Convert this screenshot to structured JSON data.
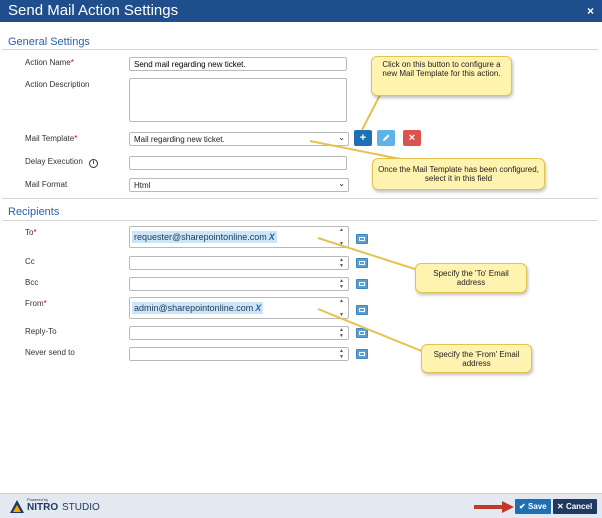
{
  "window": {
    "title": "Send Mail Action Settings",
    "close_glyph": "×"
  },
  "general": {
    "heading": "General Settings",
    "action_name_label": "Action Name",
    "action_name_value": "Send mail regarding new ticket.",
    "action_description_label": "Action Description",
    "action_description_value": "",
    "mail_template_label": "Mail Template",
    "mail_template_value": "Mail regarding new ticket.",
    "add_glyph": "+",
    "delete_glyph": "×",
    "delay_execution_label": "Delay Execution",
    "delay_execution_value": "",
    "info_glyph": "i",
    "mail_format_label": "Mail Format",
    "mail_format_value": "Html",
    "required_mark": "*"
  },
  "recipients": {
    "heading": "Recipients",
    "to_label": "To",
    "to_token": "requester@sharepointonline.com",
    "cc_label": "Cc",
    "bcc_label": "Bcc",
    "from_label": "From",
    "from_token": "admin@sharepointonline.com",
    "reply_to_label": "Reply-To",
    "never_send_label": "Never send to",
    "remove_glyph": "X"
  },
  "callouts": {
    "configure": "Click on this button to configure a new Mail Template for this action.",
    "select": "Once the Mail Template has been configured, select it in this field",
    "to": "Specify the 'To' Email address",
    "from": "Specify the 'From' Email address"
  },
  "footer": {
    "powered_by": "Powered by",
    "brand_bold": "NITRO",
    "brand_light": "STUDIO",
    "save_label": "Save",
    "cancel_label": "Cancel",
    "check_glyph": "✔",
    "cancel_glyph": "✕"
  },
  "colors": {
    "titlebar": "#1f4e8c",
    "add_button": "#1f6fb5",
    "edit_button": "#5bb4e5",
    "delete_button": "#d9534f",
    "save_button": "#1f6fb5",
    "cancel_button": "#1f3a60",
    "callout": "#fff3b0"
  }
}
